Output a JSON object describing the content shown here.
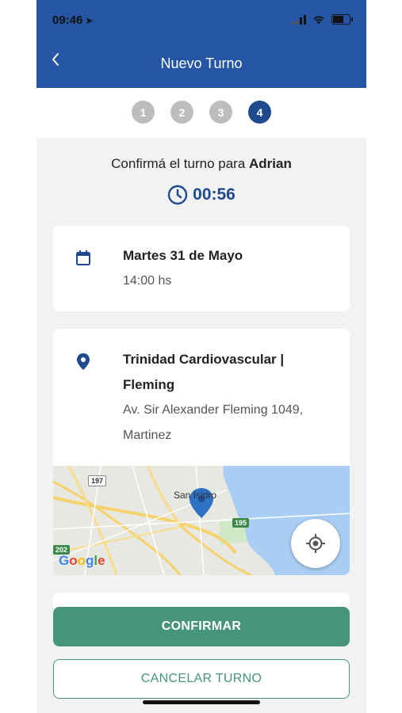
{
  "status_bar": {
    "time": "09:46"
  },
  "header": {
    "title": "Nuevo Turno",
    "back_icon": "chevron-left-icon"
  },
  "steps": [
    "1",
    "2",
    "3",
    "4"
  ],
  "active_step": "4",
  "confirmation": {
    "prefix": "Confirmá el turno para ",
    "patient_name": "Adrian",
    "timer": "00:56"
  },
  "appointment": {
    "date": "Martes 31 de Mayo",
    "time": "14:00 hs"
  },
  "location": {
    "name_line1": "Trinidad Cardiovascular |",
    "name_line2": "Fleming",
    "address_line1": "Av. Sir Alexander Fleming 1049,",
    "address_line2": "Martinez"
  },
  "map": {
    "place_label": "San Isidro",
    "road_197": "197",
    "road_195": "195",
    "road_202": "202",
    "provider": [
      "G",
      "o",
      "o",
      "g",
      "l",
      "e"
    ]
  },
  "actions": {
    "confirm_label": "CONFIRMAR",
    "cancel_label": "CANCELAR TURNO"
  },
  "colors": {
    "header_bg": "#2556a6",
    "accent_blue": "#1f4a8e",
    "confirm_green": "#479579",
    "step_inactive": "#bdbdbd"
  }
}
